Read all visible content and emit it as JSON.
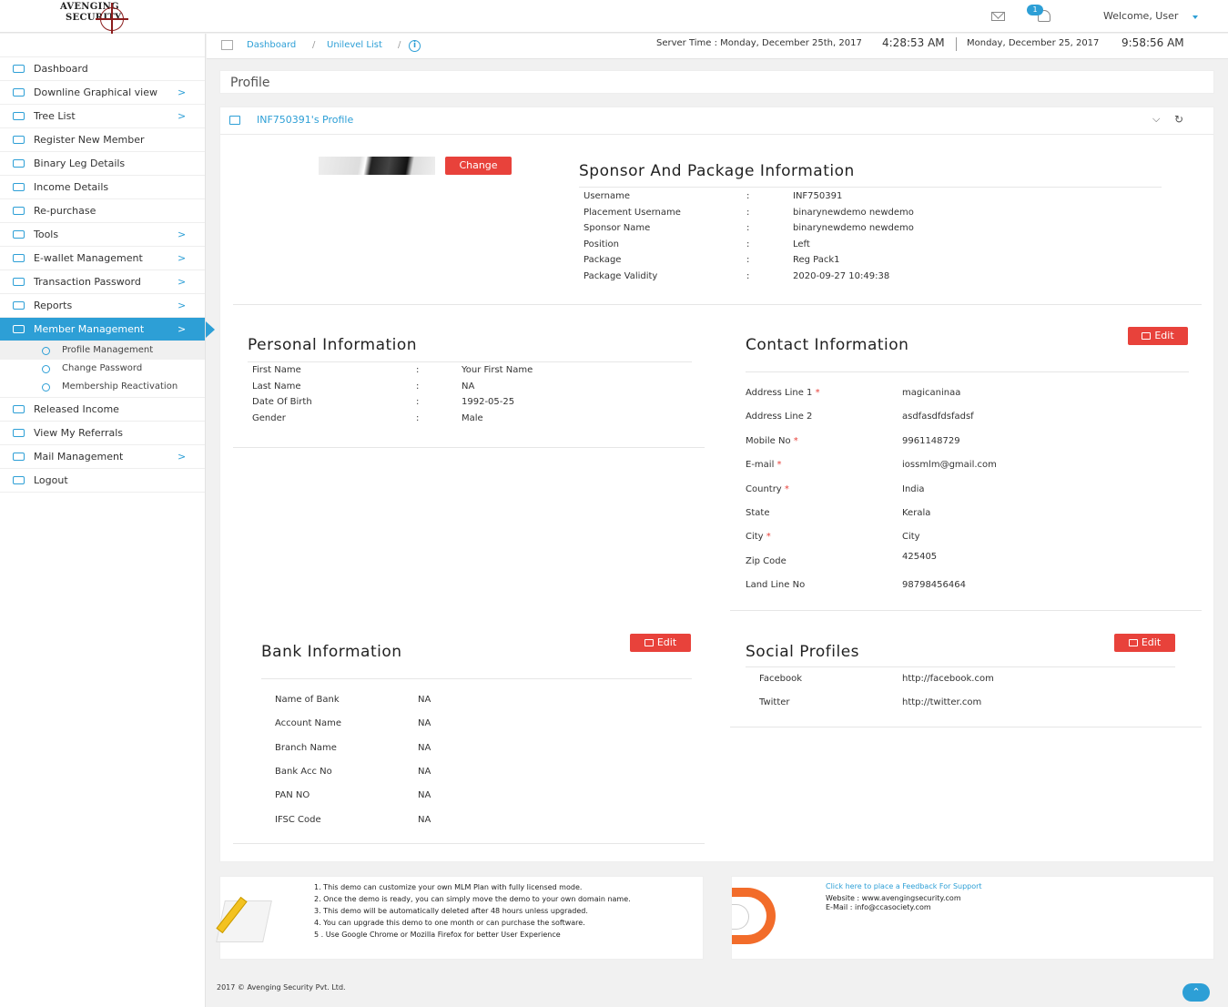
{
  "header": {
    "logo_line1": "AVENGING",
    "logo_line2": "SECURITY",
    "notification_count": "1",
    "welcome": "Welcome, User"
  },
  "sidebar": {
    "items": [
      {
        "label": "Dashboard",
        "has_submenu": false
      },
      {
        "label": "Downline Graphical view",
        "has_submenu": true
      },
      {
        "label": "Tree List",
        "has_submenu": true
      },
      {
        "label": "Register New Member",
        "has_submenu": false
      },
      {
        "label": "Binary Leg Details",
        "has_submenu": false
      },
      {
        "label": "Income Details",
        "has_submenu": false
      },
      {
        "label": "Re-purchase",
        "has_submenu": false
      },
      {
        "label": "Tools",
        "has_submenu": true
      },
      {
        "label": "E-wallet Management",
        "has_submenu": true
      },
      {
        "label": "Transaction Password",
        "has_submenu": true
      },
      {
        "label": "Reports",
        "has_submenu": true
      },
      {
        "label": "Member Management",
        "has_submenu": true,
        "active": true
      }
    ],
    "subitems": [
      {
        "label": "Profile Management"
      },
      {
        "label": "Change Password"
      },
      {
        "label": "Membership Reactivation"
      }
    ],
    "items_after": [
      {
        "label": "Released Income",
        "has_submenu": false
      },
      {
        "label": "View My Referrals",
        "has_submenu": false
      },
      {
        "label": "Mail Management",
        "has_submenu": true
      },
      {
        "label": "Logout",
        "has_submenu": false
      }
    ],
    "chevron": ">"
  },
  "breadcrumb": {
    "items": [
      "Dashboard",
      "Unilevel List"
    ],
    "separator": "/",
    "info": "i"
  },
  "time": {
    "server_time": "Server Time : Monday, December 25th, 2017",
    "server_clock": "4:28:53 AM",
    "local_date": "Monday, December 25, 2017",
    "local_clock": "9:58:56 AM"
  },
  "page": {
    "title": "Profile",
    "panel_title": "INF750391's Profile",
    "change_button": "Change",
    "edit_button": "Edit",
    "collapse": "⌵",
    "refresh": "↻"
  },
  "sponsor": {
    "title": "Sponsor And Package Information",
    "rows": [
      {
        "label": "Username",
        "value": "INF750391"
      },
      {
        "label": "Placement Username",
        "value": "binarynewdemo newdemo"
      },
      {
        "label": "Sponsor Name",
        "value": "binarynewdemo newdemo"
      },
      {
        "label": "Position",
        "value": "Left"
      },
      {
        "label": "Package",
        "value": "Reg Pack1"
      },
      {
        "label": "Package Validity",
        "value": "2020-09-27 10:49:38"
      }
    ]
  },
  "personal": {
    "title": "Personal Information",
    "rows": [
      {
        "label": "First Name",
        "value": "Your First Name"
      },
      {
        "label": "Last Name",
        "value": "NA"
      },
      {
        "label": "Date Of Birth",
        "value": "1992-05-25"
      },
      {
        "label": "Gender",
        "value": "Male"
      }
    ]
  },
  "contact": {
    "title": "Contact Information",
    "rows": [
      {
        "label": "Address Line 1",
        "required": true,
        "value": "magicaninaa"
      },
      {
        "label": "Address Line 2",
        "required": false,
        "value": "asdfasdfdsfadsf"
      },
      {
        "label": "Mobile No",
        "required": true,
        "value": "9961148729"
      },
      {
        "label": "E-mail",
        "required": true,
        "value": "iossmlm@gmail.com"
      },
      {
        "label": "Country",
        "required": true,
        "value": "India"
      },
      {
        "label": "State",
        "required": false,
        "value": "Kerala"
      },
      {
        "label": "City",
        "required": true,
        "value": "City"
      },
      {
        "label": "Zip Code",
        "required": false,
        "value": "425405"
      },
      {
        "label": "Land Line No",
        "required": false,
        "value": "98798456464"
      }
    ]
  },
  "bank": {
    "title": "Bank Information",
    "rows": [
      {
        "label": "Name of Bank",
        "value": "NA"
      },
      {
        "label": "Account Name",
        "value": "NA"
      },
      {
        "label": "Branch Name",
        "value": "NA"
      },
      {
        "label": "Bank Acc No",
        "value": "NA"
      },
      {
        "label": "PAN NO",
        "value": "NA"
      },
      {
        "label": "IFSC Code",
        "value": "NA"
      }
    ]
  },
  "social": {
    "title": "Social Profiles",
    "rows": [
      {
        "label": "Facebook",
        "value": "http://facebook.com"
      },
      {
        "label": "Twitter",
        "value": "http://twitter.com"
      }
    ]
  },
  "notes": {
    "lines": [
      "1. This demo can customize your own MLM Plan with fully licensed mode.",
      "2. Once the demo is ready, you can simply move the demo to your own domain name.",
      "3. This demo will be automatically deleted after 48 hours unless upgraded.",
      "4. You can upgrade this demo to one month or can purchase the software.",
      "5 . Use Google Chrome or Mozilla Firefox for better User Experience"
    ]
  },
  "support": {
    "link": "Click here to place a Feedback For Support",
    "website": "Website : www.avengingsecurity.com",
    "email": "E-Mail : info@ccasociety.com"
  },
  "footer": {
    "copyright": "2017 © Avenging Security Pvt. Ltd.",
    "scroll_top": "⌃"
  },
  "colors": {
    "accent": "#2d9fd6",
    "danger": "#e8423b"
  }
}
